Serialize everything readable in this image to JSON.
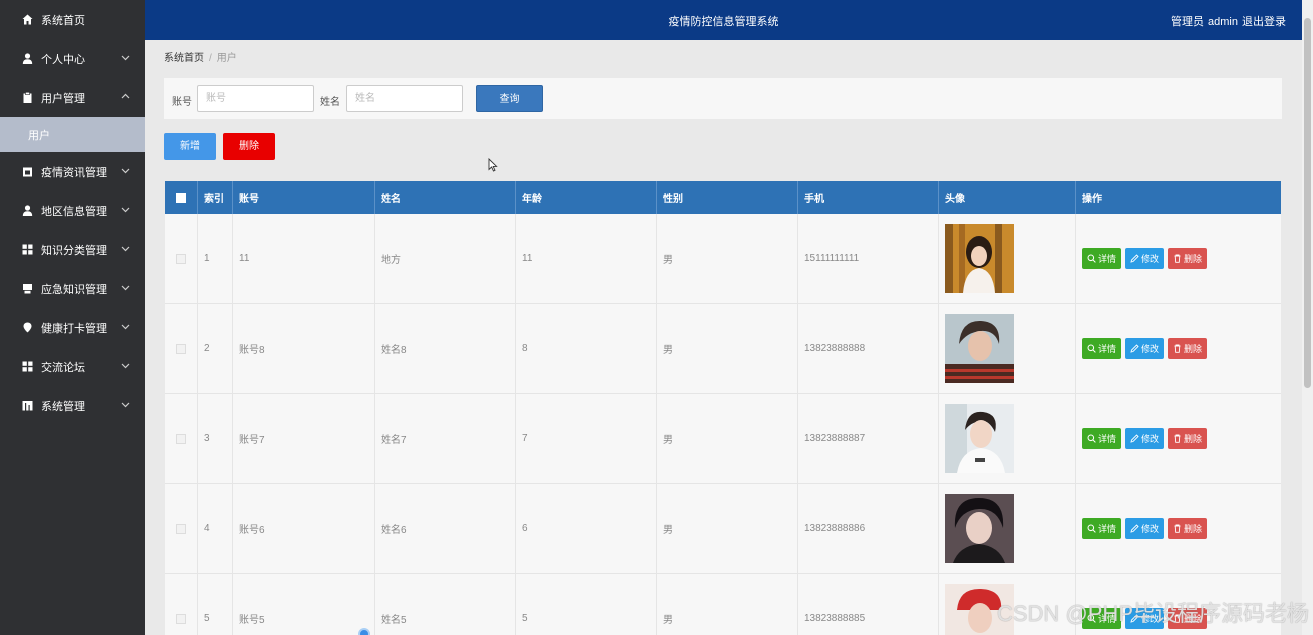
{
  "sidebar": {
    "items": [
      {
        "label": "系统首页",
        "icon": "home-icon"
      },
      {
        "label": "个人中心",
        "icon": "person-icon"
      },
      {
        "label": "用户管理",
        "icon": "clipboard-icon"
      },
      {
        "label": "疫情资讯管理",
        "icon": "calendar-icon"
      },
      {
        "label": "地区信息管理",
        "icon": "person-icon"
      },
      {
        "label": "知识分类管理",
        "icon": "grid-icon"
      },
      {
        "label": "应急知识管理",
        "icon": "printer-icon"
      },
      {
        "label": "健康打卡管理",
        "icon": "location-pin-icon"
      },
      {
        "label": "交流论坛",
        "icon": "grid-icon"
      },
      {
        "label": "系统管理",
        "icon": "bar-chart-icon"
      }
    ],
    "sub_item": "用户"
  },
  "header": {
    "title": "疫情防控信息管理系统",
    "role": "管理员",
    "username": "admin",
    "logout": "退出登录"
  },
  "breadcrumb": {
    "home": "系统首页",
    "separator": "/",
    "current": "用户"
  },
  "search": {
    "account_label": "账号",
    "account_placeholder": "账号",
    "name_label": "姓名",
    "name_placeholder": "姓名",
    "query_button": "查询"
  },
  "toolbar": {
    "add": "新增",
    "delete": "删除"
  },
  "table": {
    "columns": [
      "索引",
      "账号",
      "姓名",
      "年龄",
      "性别",
      "手机",
      "头像",
      "操作"
    ],
    "rows": [
      {
        "index": "1",
        "account": "11",
        "name": "地方",
        "age": "11",
        "gender": "男",
        "phone": "15111111111"
      },
      {
        "index": "2",
        "account": "账号8",
        "name": "姓名8",
        "age": "8",
        "gender": "男",
        "phone": "13823888888"
      },
      {
        "index": "3",
        "account": "账号7",
        "name": "姓名7",
        "age": "7",
        "gender": "男",
        "phone": "13823888887"
      },
      {
        "index": "4",
        "account": "账号6",
        "name": "姓名6",
        "age": "6",
        "gender": "男",
        "phone": "13823888886"
      },
      {
        "index": "5",
        "account": "账号5",
        "name": "姓名5",
        "age": "5",
        "gender": "男",
        "phone": "13823888885"
      }
    ],
    "actions": {
      "detail": "详情",
      "edit": "修改",
      "delete": "删除"
    }
  },
  "watermark": "CSDN @PHP毕设程序源码老杨",
  "colors": {
    "header": "#0b3a86",
    "sidebar": "#2f3033",
    "table_header": "#2e72b5",
    "add_button": "#4497e8",
    "delete_button": "#e80000",
    "detail_action": "#3eaa24",
    "edit_action": "#2b9ce5",
    "delete_action": "#d9534f"
  }
}
